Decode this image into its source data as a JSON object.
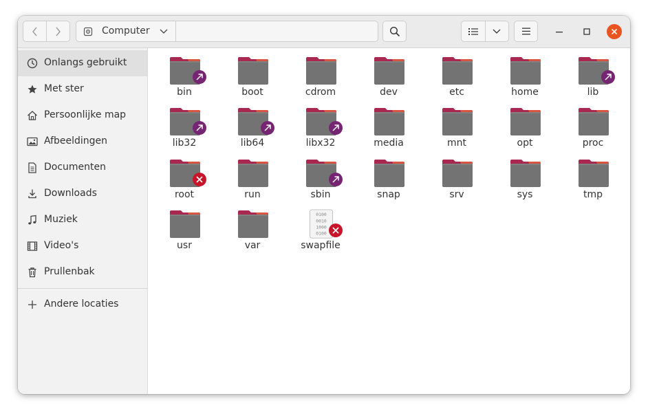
{
  "toolbar": {
    "back_icon": "chevron-left-icon",
    "forward_icon": "chevron-right-icon",
    "location_label": "Computer",
    "location_icon": "drive-icon",
    "search_icon": "search-icon",
    "view_icon": "list-view-icon",
    "view_options_icon": "chevron-down-icon",
    "menu_icon": "hamburger-menu-icon"
  },
  "window_controls": {
    "minimize_icon": "minimize-icon",
    "maximize_icon": "maximize-icon",
    "close_icon": "close-icon",
    "close_color": "#e95420"
  },
  "sidebar": {
    "items": [
      {
        "label": "Onlangs gebruikt",
        "icon": "clock-icon",
        "active": true
      },
      {
        "label": "Met ster",
        "icon": "star-icon"
      },
      {
        "label": "Persoonlijke map",
        "icon": "home-icon"
      },
      {
        "label": "Afbeeldingen",
        "icon": "image-icon"
      },
      {
        "label": "Documenten",
        "icon": "document-icon"
      },
      {
        "label": "Downloads",
        "icon": "download-icon"
      },
      {
        "label": "Muziek",
        "icon": "music-icon"
      },
      {
        "label": "Video's",
        "icon": "video-icon"
      },
      {
        "label": "Prullenbak",
        "icon": "trash-icon"
      }
    ],
    "other_locations": {
      "label": "Andere locaties",
      "icon": "plus-icon"
    }
  },
  "files": [
    {
      "name": "bin",
      "type": "folder",
      "emblem": "symlink"
    },
    {
      "name": "boot",
      "type": "folder",
      "emblem": ""
    },
    {
      "name": "cdrom",
      "type": "folder",
      "emblem": ""
    },
    {
      "name": "dev",
      "type": "folder",
      "emblem": ""
    },
    {
      "name": "etc",
      "type": "folder",
      "emblem": ""
    },
    {
      "name": "home",
      "type": "folder",
      "emblem": ""
    },
    {
      "name": "lib",
      "type": "folder",
      "emblem": "symlink"
    },
    {
      "name": "lib32",
      "type": "folder",
      "emblem": "symlink"
    },
    {
      "name": "lib64",
      "type": "folder",
      "emblem": "symlink"
    },
    {
      "name": "libx32",
      "type": "folder",
      "emblem": "symlink"
    },
    {
      "name": "media",
      "type": "folder",
      "emblem": ""
    },
    {
      "name": "mnt",
      "type": "folder",
      "emblem": ""
    },
    {
      "name": "opt",
      "type": "folder",
      "emblem": ""
    },
    {
      "name": "proc",
      "type": "folder",
      "emblem": ""
    },
    {
      "name": "root",
      "type": "folder",
      "emblem": "unreadable"
    },
    {
      "name": "run",
      "type": "folder",
      "emblem": ""
    },
    {
      "name": "sbin",
      "type": "folder",
      "emblem": "symlink"
    },
    {
      "name": "snap",
      "type": "folder",
      "emblem": ""
    },
    {
      "name": "srv",
      "type": "folder",
      "emblem": ""
    },
    {
      "name": "sys",
      "type": "folder",
      "emblem": ""
    },
    {
      "name": "tmp",
      "type": "folder",
      "emblem": ""
    },
    {
      "name": "usr",
      "type": "folder",
      "emblem": ""
    },
    {
      "name": "var",
      "type": "folder",
      "emblem": ""
    },
    {
      "name": "swapfile",
      "type": "binary-file",
      "emblem": "unreadable"
    }
  ],
  "colors": {
    "folder_body": "#737373",
    "folder_tab": "#a8284f",
    "folder_tab_accent": "#e8643c",
    "symlink_emblem": "#762572",
    "unreadable_emblem": "#c7162b"
  }
}
